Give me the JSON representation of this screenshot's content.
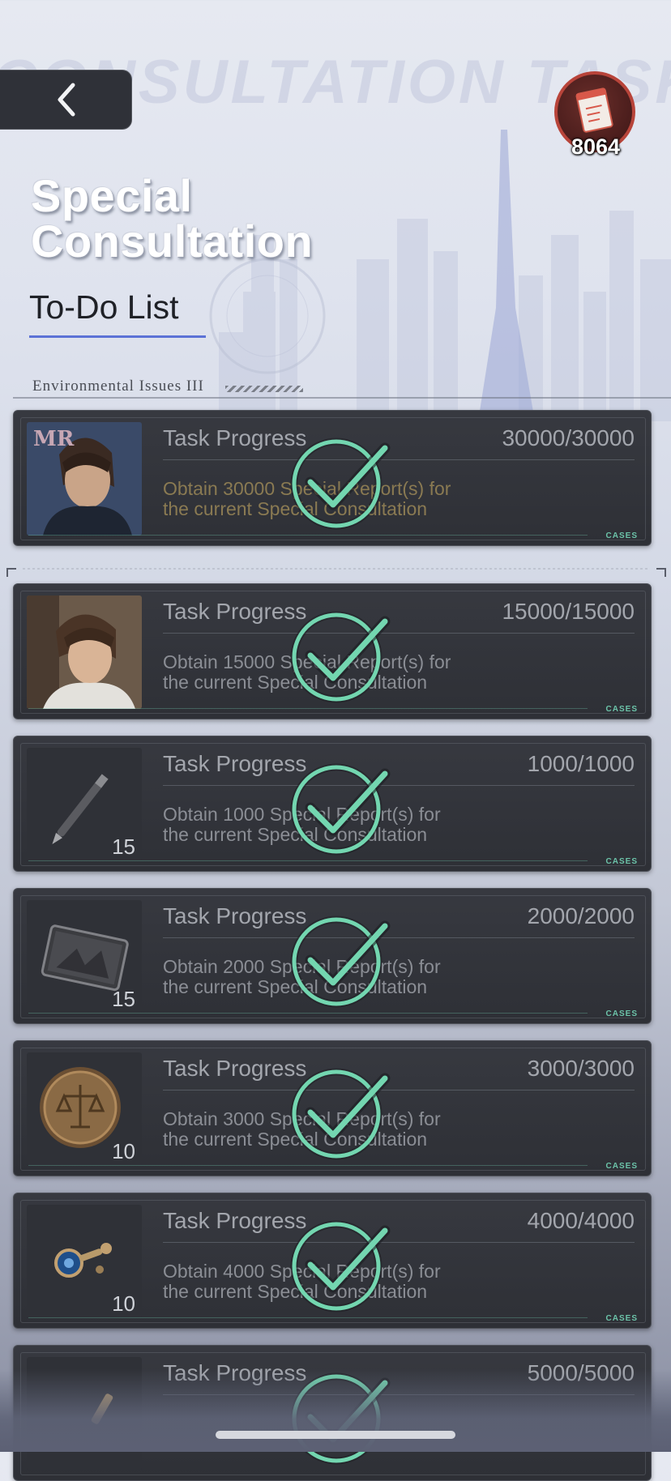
{
  "header": {
    "background_word": "CONSULTATION TASK",
    "back_icon": "chevron-left-icon",
    "currency": {
      "icon": "special-report-icon",
      "count": "8064"
    }
  },
  "title": {
    "line1": "Special",
    "line2": "Consultation",
    "subtitle": "To-Do List"
  },
  "section": {
    "label": "Environmental Issues III"
  },
  "tasks": [
    {
      "progress_label": "Task Progress",
      "progress_value": "30000/30000",
      "desc_line1": "Obtain 30000 Special Report(s) for",
      "desc_line2": "the current Special Consultation",
      "reward": "portrait-card-mr",
      "reward_logo": "MR",
      "qty": "",
      "completed": true,
      "badge": "CASES"
    },
    {
      "progress_label": "Task Progress",
      "progress_value": "15000/15000",
      "desc_line1": "Obtain 15000 Special Report(s) for",
      "desc_line2": "the current Special Consultation",
      "reward": "portrait-card",
      "qty": "",
      "completed": true,
      "badge": "CASES"
    },
    {
      "progress_label": "Task Progress",
      "progress_value": "1000/1000",
      "desc_line1": "Obtain 1000 Special Report(s) for",
      "desc_line2": "the current Special Consultation",
      "reward": "pen-icon",
      "qty": "15",
      "completed": true,
      "badge": "CASES"
    },
    {
      "progress_label": "Task Progress",
      "progress_value": "2000/2000",
      "desc_line1": "Obtain 2000 Special Report(s) for",
      "desc_line2": "the current Special Consultation",
      "reward": "tablet-icon",
      "qty": "15",
      "completed": true,
      "badge": "CASES"
    },
    {
      "progress_label": "Task Progress",
      "progress_value": "3000/3000",
      "desc_line1": "Obtain 3000 Special Report(s) for",
      "desc_line2": "the current Special Consultation",
      "reward": "scales-coin-icon",
      "qty": "10",
      "completed": true,
      "badge": "CASES"
    },
    {
      "progress_label": "Task Progress",
      "progress_value": "4000/4000",
      "desc_line1": "Obtain 4000 Special Report(s) for",
      "desc_line2": "the current Special Consultation",
      "reward": "cufflinks-icon",
      "qty": "10",
      "completed": true,
      "badge": "CASES"
    },
    {
      "progress_label": "Task Progress",
      "progress_value": "5000/5000",
      "desc_line1": "",
      "desc_line2": "",
      "reward": "item-icon",
      "qty": "",
      "completed": true,
      "badge": ""
    }
  ],
  "colors": {
    "accent_check": "#73d6b0",
    "title_underline": "#5c72d6",
    "card_bg": "#33353b",
    "cases_badge": "#6cc3a9"
  }
}
